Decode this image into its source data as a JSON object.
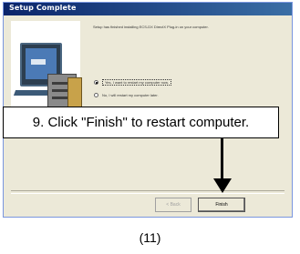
{
  "dialog": {
    "title": "Setup Complete",
    "message": "Setup has finished installing ECS-DX DirectX Plug-in on your computer.",
    "options": [
      {
        "label": "Yes, I want to restart my computer now.",
        "selected": true
      },
      {
        "label": "No, I will restart my computer later.",
        "selected": false
      }
    ],
    "back_label": "< Back",
    "finish_label": "Finish"
  },
  "callout": {
    "text": "9. Click \"Finish\" to restart computer."
  },
  "caption": "(11)"
}
